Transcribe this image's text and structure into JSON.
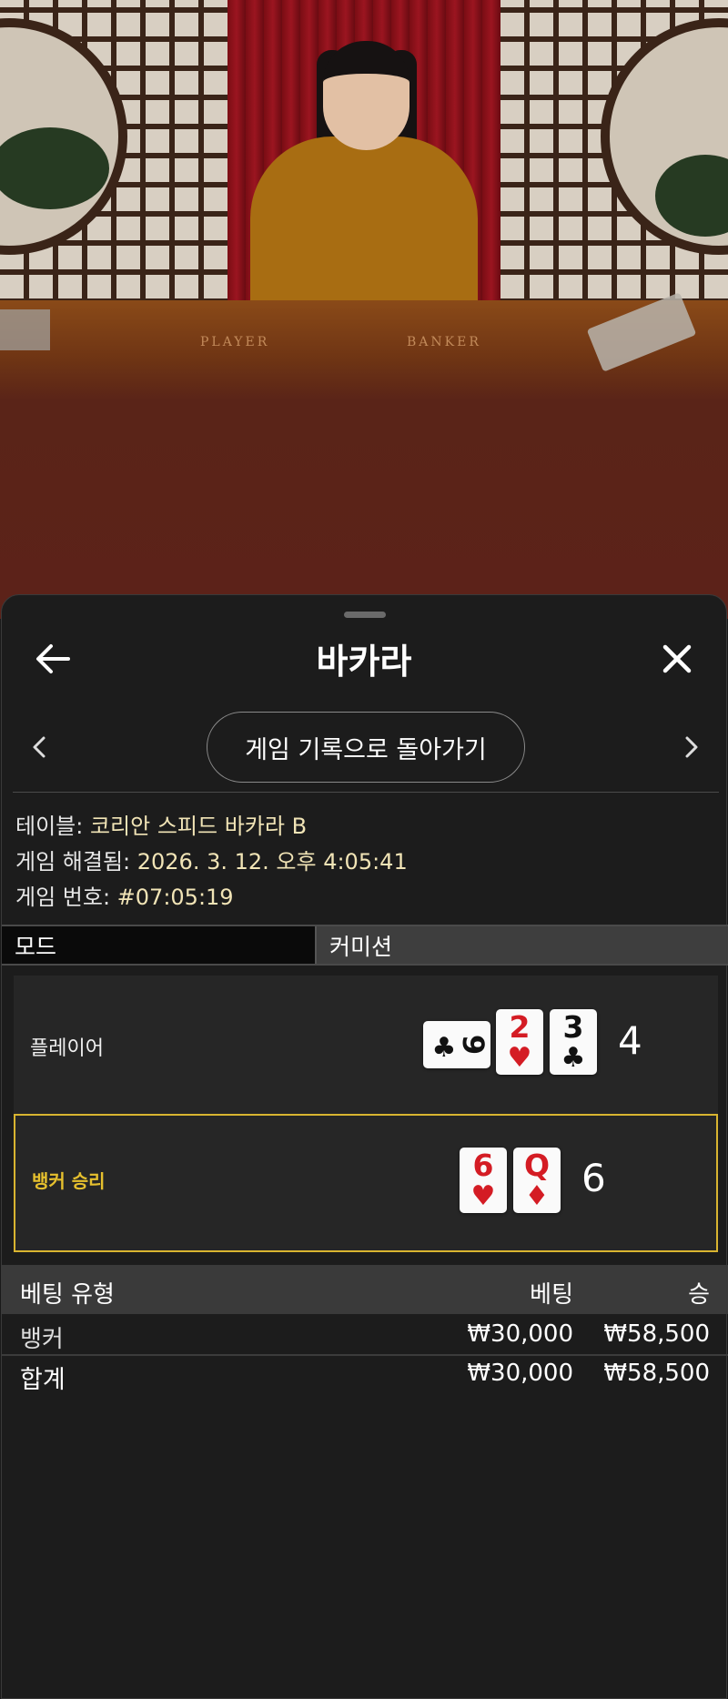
{
  "video": {
    "felt_player": "PLAYER",
    "felt_banker": "BANKER"
  },
  "header": {
    "title": "바카라",
    "back_icon": "arrow-left-icon",
    "close_icon": "close-icon"
  },
  "nav": {
    "return_label": "게임 기록으로 돌아가기",
    "prev_icon": "chevron-left-icon",
    "next_icon": "chevron-right-icon"
  },
  "info": {
    "table_label": "테이블: ",
    "table_value": "코리안 스피드 바카라 B",
    "resolved_label": "게임 해결됨: ",
    "resolved_value": "2026. 3. 12. 오후 4:05:41",
    "number_label": "게임 번호: ",
    "number_value": "#07:05:19"
  },
  "tabs": {
    "mode": "모드",
    "commission": "커미션"
  },
  "hands": {
    "player": {
      "label": "플레이어",
      "score": "4",
      "cards": [
        {
          "rank": "9",
          "suit": "♣",
          "color": "black",
          "sideways": true
        },
        {
          "rank": "2",
          "suit": "♥",
          "color": "red"
        },
        {
          "rank": "3",
          "suit": "♣",
          "color": "black"
        }
      ]
    },
    "banker": {
      "label": "뱅커 승리",
      "score": "6",
      "cards": [
        {
          "rank": "6",
          "suit": "♥",
          "color": "red"
        },
        {
          "rank": "Q",
          "suit": "♦",
          "color": "red"
        }
      ]
    }
  },
  "bets": {
    "headers": {
      "type": "베팅 유형",
      "bet": "베팅",
      "win": "승"
    },
    "rows": [
      {
        "type": "뱅커",
        "bet": "₩30,000",
        "win": "₩58,500"
      }
    ],
    "total": {
      "type": "합계",
      "bet": "₩30,000",
      "win": "₩58,500"
    }
  },
  "colors": {
    "accent": "#d8b430",
    "info_value": "#f1e4b6",
    "sheet_bg": "#1c1c1c",
    "card_red": "#d41c24"
  }
}
